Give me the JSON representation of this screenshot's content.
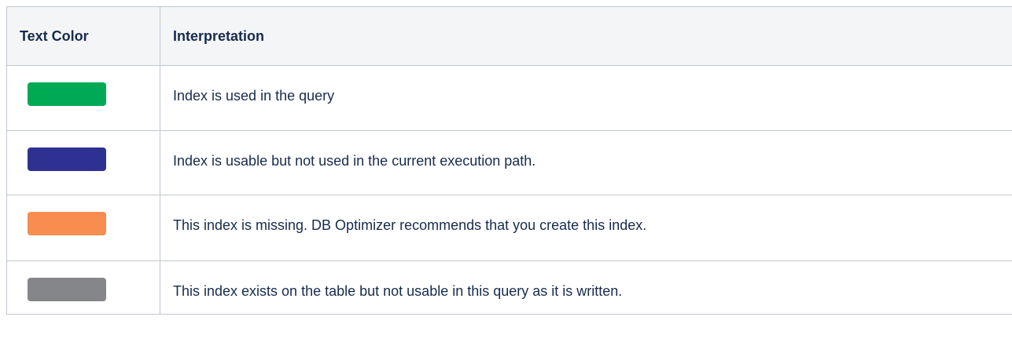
{
  "table": {
    "headers": {
      "text_color": "Text Color",
      "interpretation": "Interpretation"
    },
    "rows": [
      {
        "swatch_color": "#00aa55",
        "color_name": "green-swatch",
        "interpretation": "Index is used in the query"
      },
      {
        "swatch_color": "#2e3192",
        "color_name": "dark-blue-swatch",
        "interpretation": "Index is usable but not used in the current execution path."
      },
      {
        "swatch_color": "#f78d4f",
        "color_name": "orange-swatch",
        "interpretation": "This index is missing. DB Optimizer recommends that you create this index."
      },
      {
        "swatch_color": "#858689",
        "color_name": "gray-swatch",
        "interpretation": "This index exists on the table but not usable in this query as it is written."
      }
    ]
  }
}
